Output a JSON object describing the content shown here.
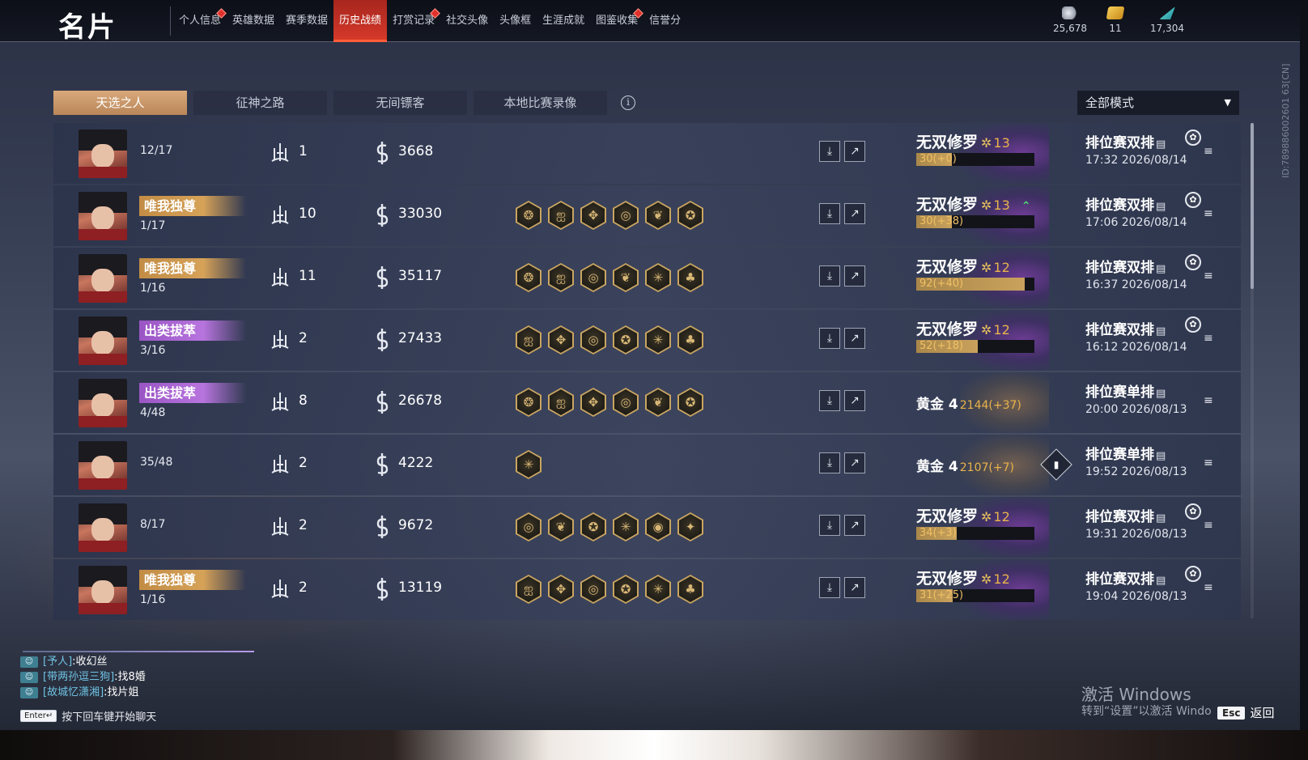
{
  "header": {
    "title": "名片",
    "nav": [
      {
        "label": "个人信息",
        "dot": true
      },
      {
        "label": "英雄数据",
        "dot": false
      },
      {
        "label": "赛季数据",
        "dot": false
      },
      {
        "label": "历史战绩",
        "dot": false,
        "active": true
      },
      {
        "label": "打赏记录",
        "dot": true
      },
      {
        "label": "社交头像",
        "dot": false
      },
      {
        "label": "头像框",
        "dot": false
      },
      {
        "label": "生涯成就",
        "dot": false
      },
      {
        "label": "图鉴收集",
        "dot": true
      },
      {
        "label": "信誉分",
        "dot": false
      }
    ],
    "currencies": [
      {
        "icon": "coin-icon",
        "value": "25,678",
        "color": "#c9ced8"
      },
      {
        "icon": "ticket-icon",
        "value": "11",
        "color": "#e8b23a"
      },
      {
        "icon": "feather-icon",
        "value": "17,304",
        "color": "#3fc9c9"
      }
    ]
  },
  "side_id": "ID:789886002601 63[CN]",
  "tabs": [
    "天选之人",
    "征神之路",
    "无间镖客",
    "本地比赛录像"
  ],
  "mode_select": "全部模式",
  "rows": [
    {
      "badge": "",
      "badge_color": "",
      "rank": "12/17",
      "kills": "1",
      "score": "3668",
      "equip": [],
      "tier": "无双修罗",
      "tier_level": "13",
      "up": "",
      "bar_text": "30(+0)",
      "bar_fill": 0.3,
      "tier2": "",
      "tier2_points": "",
      "match": "排位赛双排",
      "time": "17:32  2026/08/14",
      "team": true
    },
    {
      "badge": "唯我独尊",
      "badge_color": "gold",
      "rank": "1/17",
      "kills": "10",
      "score": "33030",
      "equip": [
        "❂",
        "ஐ",
        "✥",
        "◎",
        "❦",
        "✪"
      ],
      "tier": "无双修罗",
      "tier_level": "13",
      "up": "⌃",
      "bar_text": "30(+38)",
      "bar_fill": 0.3,
      "tier2": "",
      "tier2_points": "",
      "match": "排位赛双排",
      "time": "17:06  2026/08/14",
      "team": true
    },
    {
      "badge": "唯我独尊",
      "badge_color": "gold",
      "rank": "1/16",
      "kills": "11",
      "score": "35117",
      "equip": [
        "❂",
        "ஐ",
        "◎",
        "❦",
        "✳",
        "♣"
      ],
      "tier": "无双修罗",
      "tier_level": "12",
      "up": "",
      "bar_text": "92(+40)",
      "bar_fill": 0.92,
      "tier2": "",
      "tier2_points": "",
      "match": "排位赛双排",
      "time": "16:37  2026/08/14",
      "team": true
    },
    {
      "badge": "出类拔萃",
      "badge_color": "purple",
      "rank": "3/16",
      "kills": "2",
      "score": "27433",
      "equip": [
        "ஐ",
        "✥",
        "◎",
        "✪",
        "✳",
        "♣"
      ],
      "tier": "无双修罗",
      "tier_level": "12",
      "up": "",
      "bar_text": "52(+18)",
      "bar_fill": 0.52,
      "tier2": "",
      "tier2_points": "",
      "match": "排位赛双排",
      "time": "16:12  2026/08/14",
      "team": true
    },
    {
      "badge": "出类拔萃",
      "badge_color": "purple",
      "rank": "4/48",
      "kills": "8",
      "score": "26678",
      "equip": [
        "❂",
        "ஐ",
        "✥",
        "◎",
        "❦",
        "✪"
      ],
      "tier": "",
      "tier_level": "",
      "up": "",
      "bar_text": "",
      "bar_fill": 0,
      "tier2": "黄金 4",
      "tier2_points": "2144(+37)",
      "match": "排位赛单排",
      "time": "20:00  2026/08/13",
      "team": false
    },
    {
      "badge": "",
      "badge_color": "",
      "rank": "35/48",
      "kills": "2",
      "score": "4222",
      "equip": [
        "✳"
      ],
      "tier": "",
      "tier_level": "",
      "up": "",
      "bar_text": "",
      "bar_fill": 0,
      "tier2": "黄金 4",
      "tier2_points": "2107(+7)",
      "match": "排位赛单排",
      "time": "19:52  2026/08/13",
      "team": false,
      "diamond": true
    },
    {
      "badge": "",
      "badge_color": "",
      "rank": "8/17",
      "kills": "2",
      "score": "9672",
      "equip": [
        "◎",
        "❦",
        "✪",
        "✳",
        "◉",
        "✦"
      ],
      "tier": "无双修罗",
      "tier_level": "12",
      "up": "",
      "bar_text": "34(+3)",
      "bar_fill": 0.34,
      "tier2": "",
      "tier2_points": "",
      "match": "排位赛双排",
      "time": "19:31  2026/08/13",
      "team": true
    },
    {
      "badge": "唯我独尊",
      "badge_color": "gold",
      "rank": "1/16",
      "kills": "2",
      "score": "13119",
      "equip": [
        "ஐ",
        "✥",
        "◎",
        "✪",
        "✳",
        "♣"
      ],
      "tier": "无双修罗",
      "tier_level": "12",
      "up": "",
      "bar_text": "31(+25)",
      "bar_fill": 0.31,
      "tier2": "",
      "tier2_points": "",
      "match": "排位赛双排",
      "time": "19:04  2026/08/13",
      "team": true
    }
  ],
  "chat": [
    {
      "name": "[予人]",
      "msg": ":收幻丝"
    },
    {
      "name": "[带两孙逗三狗]",
      "msg": ":找8婚"
    },
    {
      "name": "[故城忆潇湘]",
      "msg": ":找片姐"
    }
  ],
  "enter_key": "Enter↵",
  "enter_hint": "按下回车键开始聊天",
  "watermark": {
    "line1": "激活 Windows",
    "line2": "转到“设置”以激活 Windo"
  },
  "esc_key": "Esc",
  "esc_label": "返回",
  "colors": {
    "accent": "#d83a2a",
    "tab_active": "#c9966a",
    "gold_badge": "#c28c45",
    "purple_badge": "#9a55c4"
  }
}
